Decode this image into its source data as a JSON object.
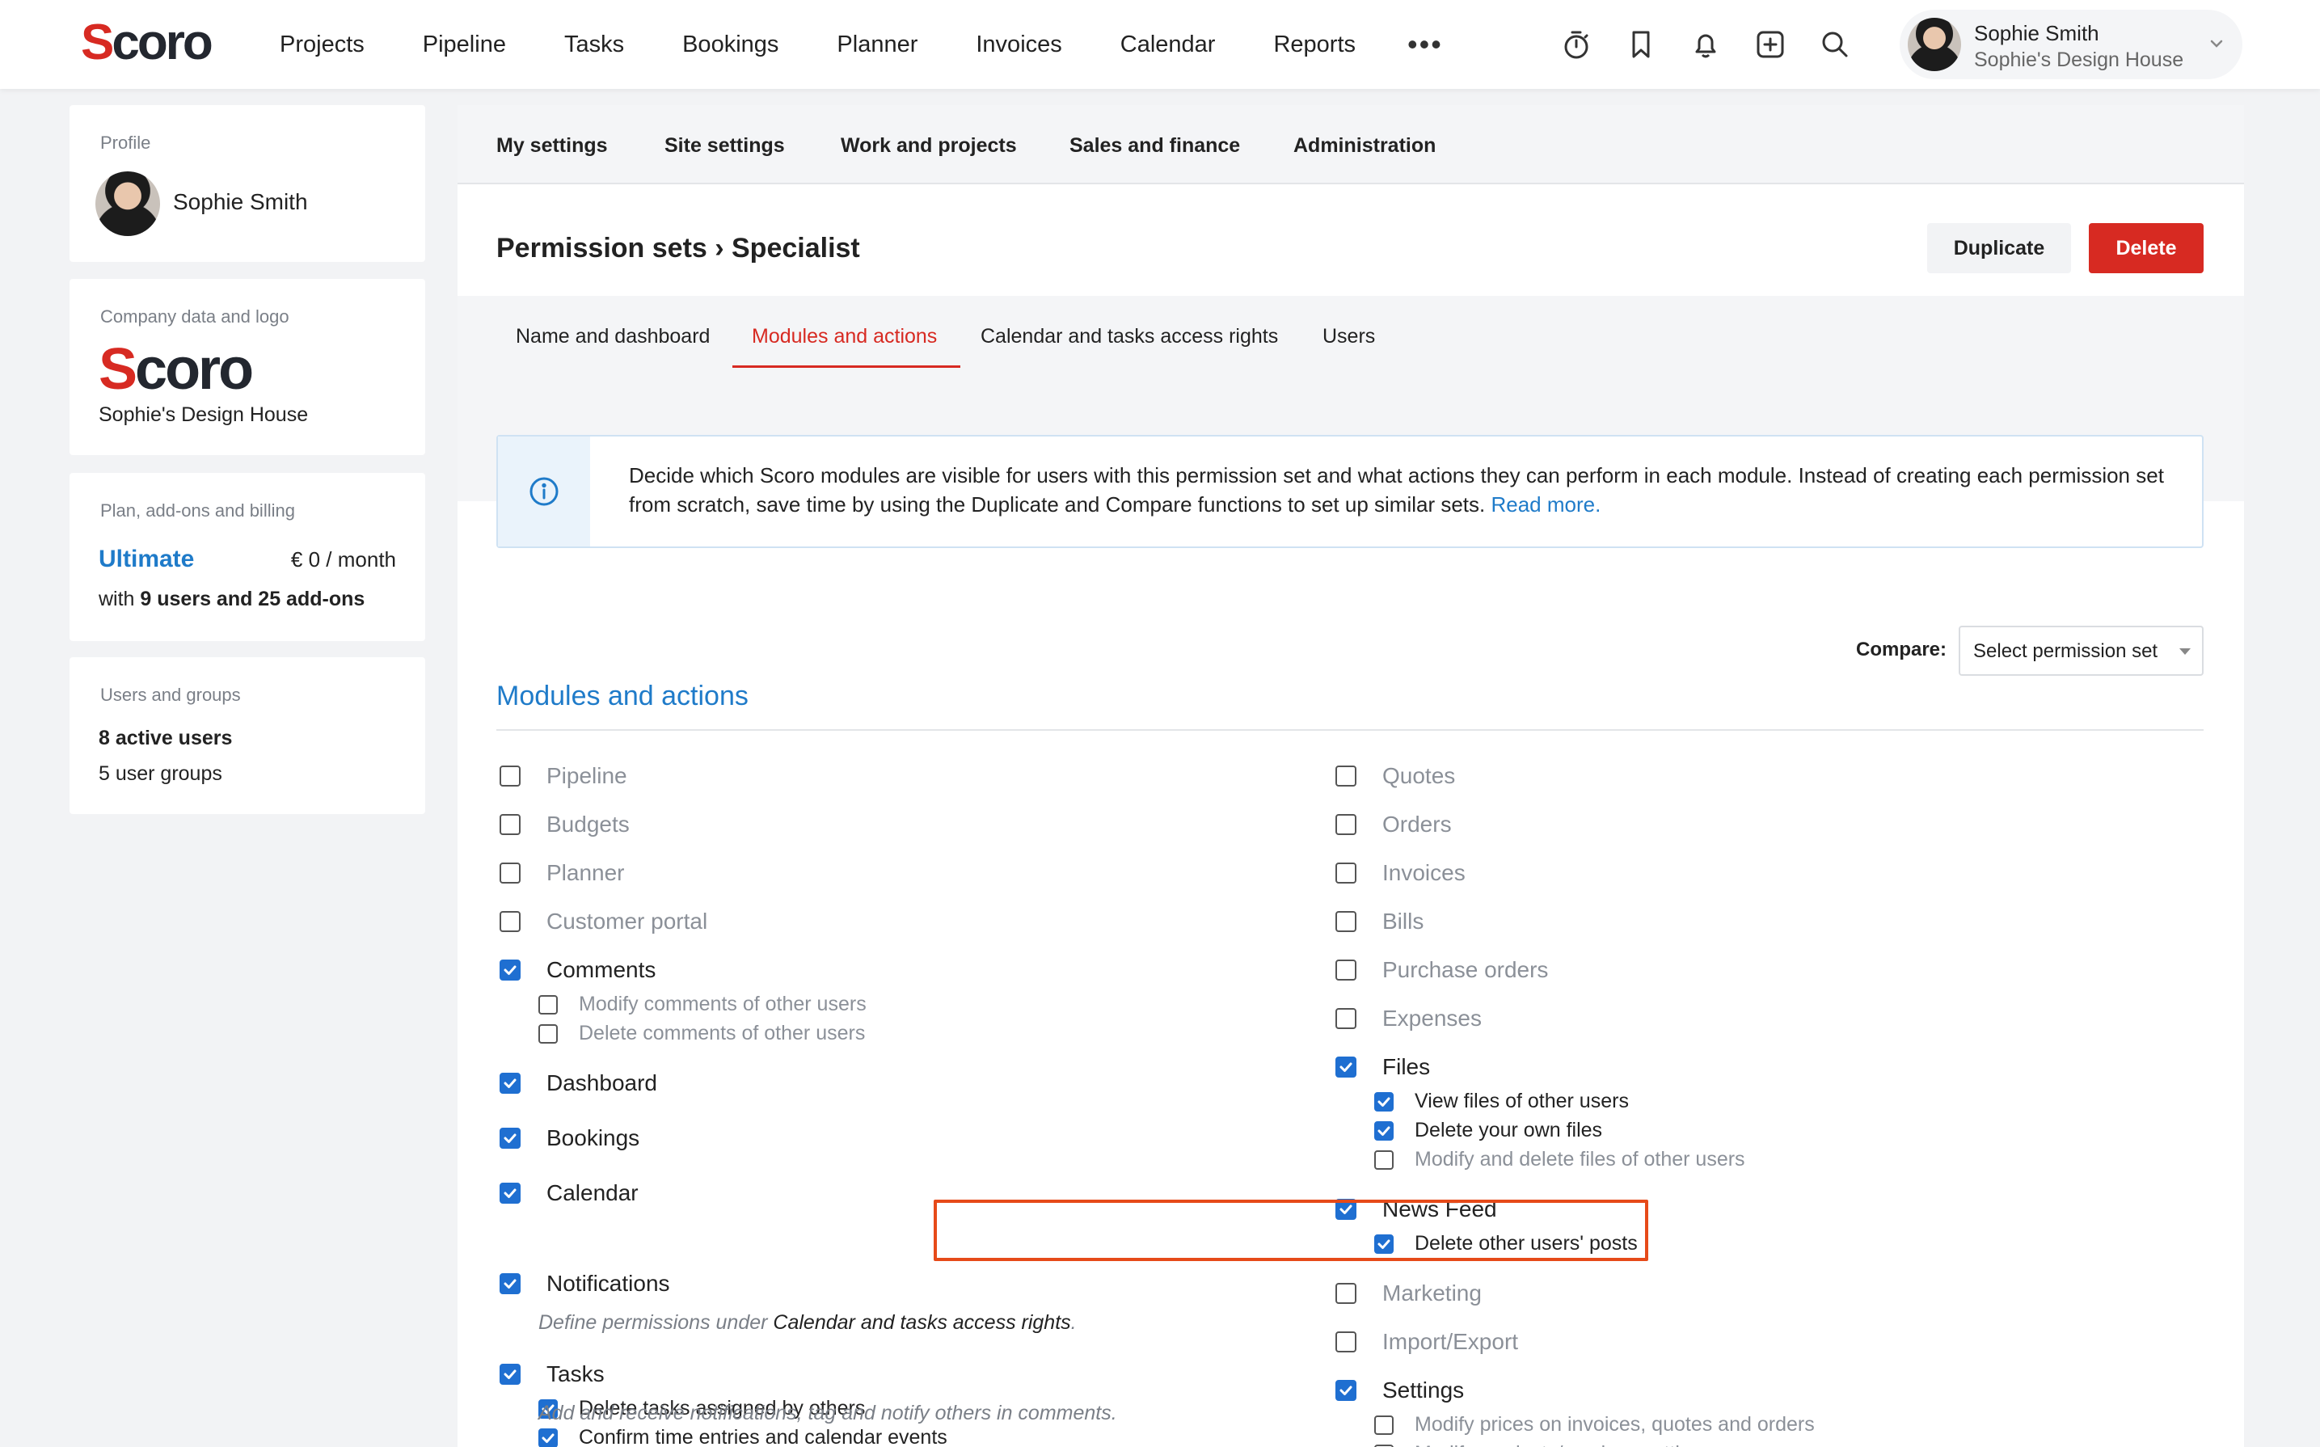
{
  "topbar": {
    "logo_mark": "S",
    "logo_rest": "coro",
    "nav": [
      "Projects",
      "Pipeline",
      "Tasks",
      "Bookings",
      "Planner",
      "Invoices",
      "Calendar",
      "Reports"
    ],
    "more": "•••",
    "icons": [
      "timer-icon",
      "bookmark-icon",
      "bell-icon",
      "add-icon",
      "search-icon"
    ],
    "user_name": "Sophie Smith",
    "user_company": "Sophie's Design House"
  },
  "sidebar": {
    "profile": {
      "title": "Profile",
      "name": "Sophie Smith"
    },
    "company": {
      "title": "Company data and logo",
      "name": "Sophie's Design House"
    },
    "plan": {
      "title": "Plan, add-ons and billing",
      "name": "Ultimate",
      "price": "€ 0 / month",
      "prefix": "with ",
      "detail": "9 users and 25 add-ons"
    },
    "users": {
      "title": "Users and groups",
      "active": "8 active users",
      "groups": "5 user groups"
    }
  },
  "main": {
    "top_tabs": [
      "My settings",
      "Site settings",
      "Work and projects",
      "Sales and finance",
      "Administration"
    ],
    "breadcrumb": "Permission sets › Specialist",
    "duplicate_label": "Duplicate",
    "delete_label": "Delete",
    "sub_tabs": [
      "Name and dashboard",
      "Modules and actions",
      "Calendar and tasks access rights",
      "Users"
    ],
    "active_sub_tab": "Modules and actions",
    "info_text": "Decide which Scoro modules are visible for users with this permission set and what actions they can perform in each module. Instead of creating each permission set from scratch, save time by using the Duplicate and Compare functions to set up similar sets. ",
    "info_link": "Read more.",
    "compare_label": "Compare:",
    "compare_placeholder": "Select permission set",
    "section_title": "Modules and actions"
  },
  "modules": {
    "left": [
      {
        "label": "Pipeline",
        "checked": false
      },
      {
        "label": "Budgets",
        "checked": false
      },
      {
        "label": "Planner",
        "checked": false
      },
      {
        "label": "Customer portal",
        "checked": false
      },
      {
        "label": "Comments",
        "checked": true
      },
      {
        "label": "Modify comments of other users",
        "checked": false,
        "sub": true
      },
      {
        "label": "Delete comments of other users",
        "checked": false,
        "sub": true
      },
      {
        "label": "Dashboard",
        "checked": true
      },
      {
        "label": "Bookings",
        "checked": true
      },
      {
        "label": "Calendar",
        "checked": true
      },
      {
        "label": "Notifications",
        "checked": true
      },
      {
        "label": "Tasks",
        "checked": true
      },
      {
        "label": "Delete tasks assigned by others",
        "checked": true,
        "sub": true
      },
      {
        "label": "Confirm time entries and calendar events",
        "checked": true,
        "sub": true
      }
    ],
    "right": [
      {
        "label": "Quotes",
        "checked": false
      },
      {
        "label": "Orders",
        "checked": false
      },
      {
        "label": "Invoices",
        "checked": false
      },
      {
        "label": "Bills",
        "checked": false
      },
      {
        "label": "Purchase orders",
        "checked": false
      },
      {
        "label": "Expenses",
        "checked": false
      },
      {
        "label": "Files",
        "checked": true
      },
      {
        "label": "View files of other users",
        "checked": true,
        "sub": true
      },
      {
        "label": "Delete your own files",
        "checked": true,
        "sub": true
      },
      {
        "label": "Modify and delete files of other users",
        "checked": false,
        "sub": true
      },
      {
        "label": "News Feed",
        "checked": true
      },
      {
        "label": "Delete other users' posts",
        "checked": true,
        "sub": true
      },
      {
        "label": "Marketing",
        "checked": false
      },
      {
        "label": "Import/Export",
        "checked": false
      },
      {
        "label": "Settings",
        "checked": true
      },
      {
        "label": "Modify prices on invoices, quotes and orders",
        "checked": false,
        "sub": true
      },
      {
        "label": "Modify products/services settings",
        "checked": false,
        "sub": true
      }
    ],
    "calendar_note_prefix": "Define permissions under ",
    "calendar_note_link": "Calendar and tasks access rights",
    "calendar_note_suffix": ".",
    "notifications_note": "Add and receive notifications, tag and notify others in comments."
  },
  "colors": {
    "accent": "#1f7bc9",
    "brand_red": "#d72a22",
    "checkbox": "#1f6fd1",
    "highlight": "#e64a19"
  }
}
